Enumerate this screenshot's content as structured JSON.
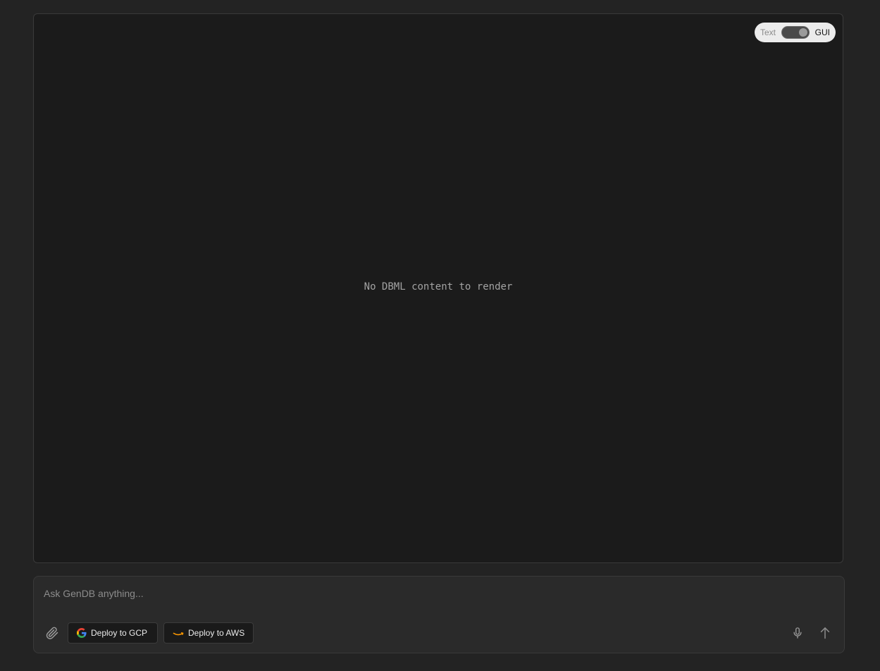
{
  "view_toggle": {
    "left_label": "Text",
    "right_label": "GUI",
    "selected": "GUI"
  },
  "canvas": {
    "empty_message": "No DBML content to render"
  },
  "chat": {
    "placeholder": "Ask GenDB anything...",
    "value": ""
  },
  "actions": {
    "deploy_gcp_label": "Deploy to GCP",
    "deploy_aws_label": "Deploy to AWS"
  },
  "icons": {
    "attach": "paperclip-icon",
    "gcp": "google-logo-icon",
    "aws": "amazon-logo-icon",
    "mic": "microphone-icon",
    "send": "arrow-up-icon"
  },
  "colors": {
    "background": "#232323",
    "panel": "#1b1b1b",
    "chat_box": "#2a2a2a",
    "toggle_bg": "#ececec",
    "aws_orange": "#f90"
  }
}
